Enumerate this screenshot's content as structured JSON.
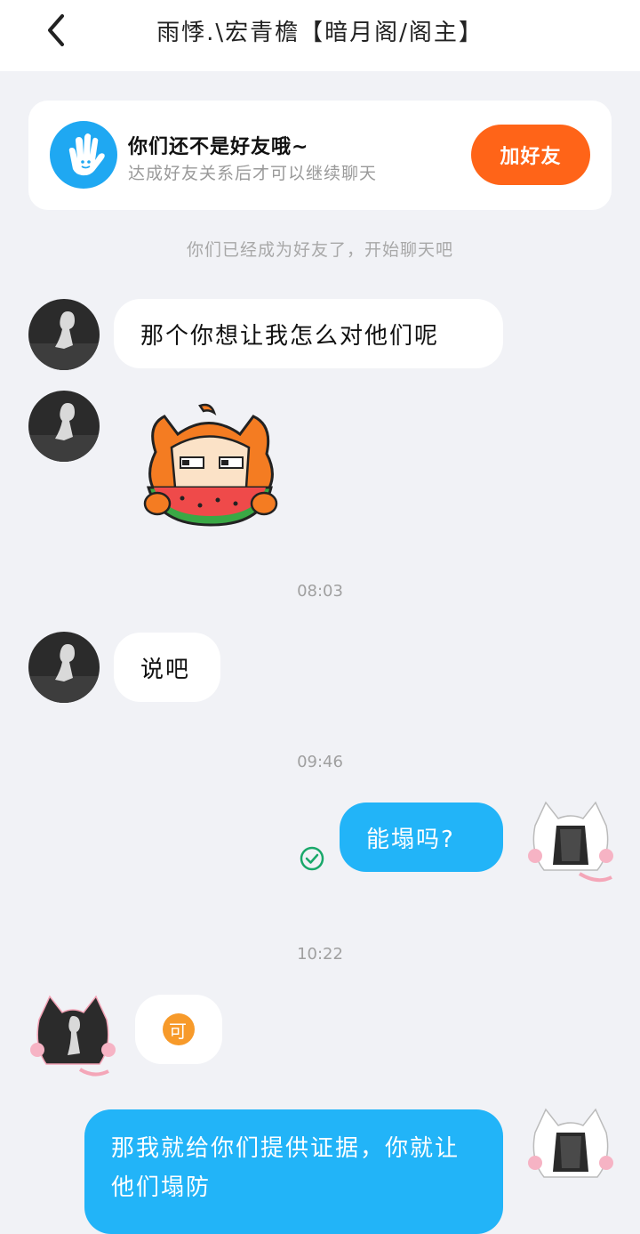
{
  "header": {
    "title": "雨悸.\\宏青檐【暗月阁/阁主】"
  },
  "banner": {
    "title": "你们还不是好友哦~",
    "subtitle": "达成好友关系后才可以继续聊天",
    "button_label": "加好友",
    "accent": "#ff6418",
    "icon": "waving-hand-icon"
  },
  "system_message": "你们已经成为好友了，开始聊天吧",
  "messages": [
    {
      "type": "text",
      "side": "left",
      "text": "那个你想让我怎么对他们呢"
    },
    {
      "type": "sticker",
      "side": "left",
      "sticker": "watermelon-cat-sticker"
    },
    {
      "type": "time",
      "text": "08:03"
    },
    {
      "type": "text",
      "side": "left",
      "text": "说吧"
    },
    {
      "type": "time",
      "text": "09:46"
    },
    {
      "type": "text",
      "side": "right",
      "text": "能塌吗?",
      "status": "read"
    },
    {
      "type": "time",
      "text": "10:22"
    },
    {
      "type": "emoji",
      "side": "left",
      "text": "可"
    },
    {
      "type": "text",
      "side": "right",
      "text": "那我就给你们提供证据，你就让他们塌防"
    }
  ],
  "colors": {
    "background": "#f1f2f6",
    "my_bubble": "#22b4f8",
    "their_bubble": "#ffffff",
    "read_check": "#19a86a"
  }
}
